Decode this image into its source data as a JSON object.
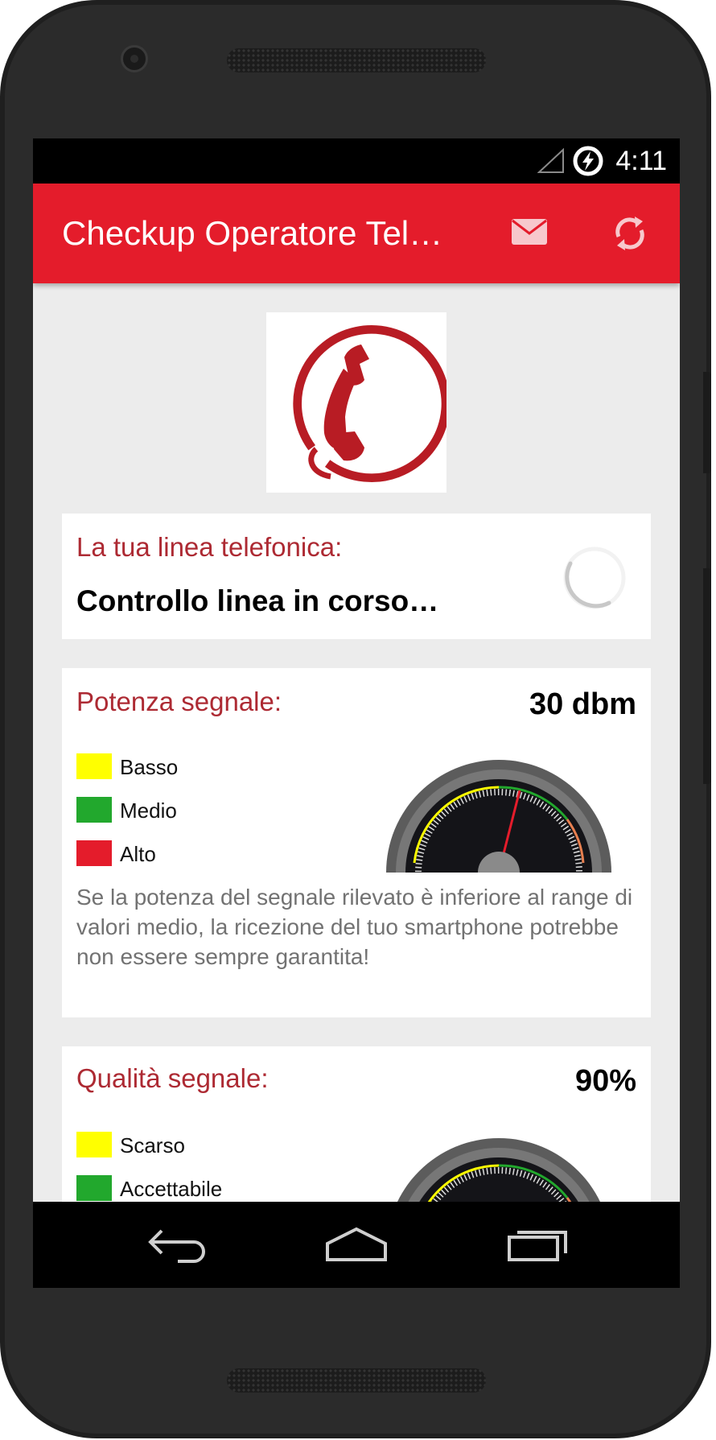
{
  "status_bar": {
    "time": "4:11",
    "icons": [
      "signal-icon",
      "battery-charging-icon"
    ]
  },
  "app_bar": {
    "title": "Checkup Operatore Tel…",
    "actions": [
      "mail-icon",
      "refresh-icon"
    ]
  },
  "line_card": {
    "label": "La tua linea telefonica:",
    "status": "Controllo linea in corso…"
  },
  "signal_power_card": {
    "label": "Potenza segnale:",
    "value": "30 dbm",
    "legend": [
      {
        "label": "Basso",
        "color": "#ffff00"
      },
      {
        "label": "Medio",
        "color": "#22a82d"
      },
      {
        "label": "Alto",
        "color": "#e41c2b"
      }
    ],
    "description": "Se la potenza del segnale rilevato è inferiore al range di valori medio, la ricezione del tuo smartphone potrebbe non essere sempre garantita!"
  },
  "signal_quality_card": {
    "label": "Qualità segnale:",
    "value": "90%",
    "legend": [
      {
        "label": "Scarso",
        "color": "#ffff00"
      },
      {
        "label": "Accettabile",
        "color": "#22a82d"
      }
    ]
  },
  "nav_bar": {
    "buttons": [
      "back-icon",
      "home-icon",
      "recents-icon"
    ]
  },
  "colors": {
    "accent": "#e41c2b",
    "label_red": "#ad2a33",
    "background": "#ececec"
  }
}
